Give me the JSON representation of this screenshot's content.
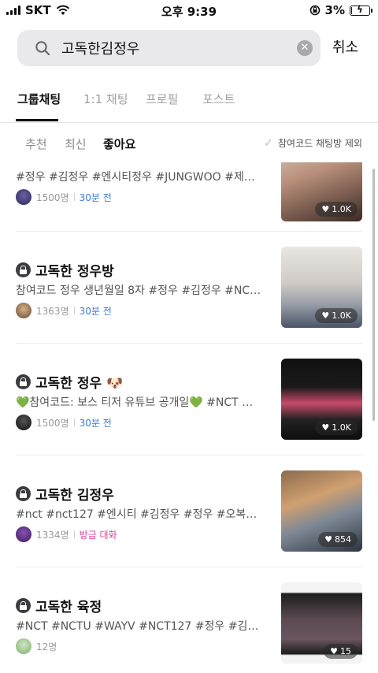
{
  "status_bar": {
    "carrier": "SKT",
    "time": "오후 9:39",
    "battery_percent": "3%",
    "battery_level": 0.03
  },
  "search": {
    "query": "고독한김정우",
    "cancel_label": "취소"
  },
  "tabs": [
    {
      "label": "그룹채팅",
      "active": true
    },
    {
      "label": "1:1 채팅",
      "active": false
    },
    {
      "label": "프로필",
      "active": false
    },
    {
      "label": "포스트",
      "active": false
    }
  ],
  "subfilters": [
    {
      "label": "추천",
      "active": false
    },
    {
      "label": "최신",
      "active": false
    },
    {
      "label": "좋아요",
      "active": true
    }
  ],
  "exclude_label": "참여코드 채팅방 제외",
  "rooms": [
    {
      "title": "",
      "locked": false,
      "desc": "#정우 #김정우 #엔시티정우 #JUNGWOO #제우스…",
      "members": "1500명",
      "activity": "30분 전",
      "activity_type": "recent",
      "likes": "1.0K"
    },
    {
      "title": "고독한 정우방",
      "locked": true,
      "desc": "참여코드 정우 생년월일 8자 #정우 #김정우 #NCT12…",
      "members": "1363명",
      "activity": "30분 전",
      "activity_type": "recent",
      "likes": "1.0K"
    },
    {
      "title": "고독한 정우 🐶",
      "locked": true,
      "desc": "💚참여코드: 보스 티저 유튜브 공개일💚 #NCT #N…",
      "members": "1500명",
      "activity": "30분 전",
      "activity_type": "recent",
      "likes": "1.0K"
    },
    {
      "title": "고독한 김정우",
      "locked": true,
      "desc": "#nct #nct127 #엔시티 #김정우 #정우 #오복이 #제…",
      "members": "1334명",
      "activity": "방금 대화",
      "activity_type": "live",
      "likes": "854"
    },
    {
      "title": "고독한 육정",
      "locked": true,
      "desc": "#NCT #NCTU #WAYV #NCT127 #정우 #김정우…",
      "members": "12명",
      "activity": "",
      "activity_type": "none",
      "likes": "15"
    }
  ]
}
